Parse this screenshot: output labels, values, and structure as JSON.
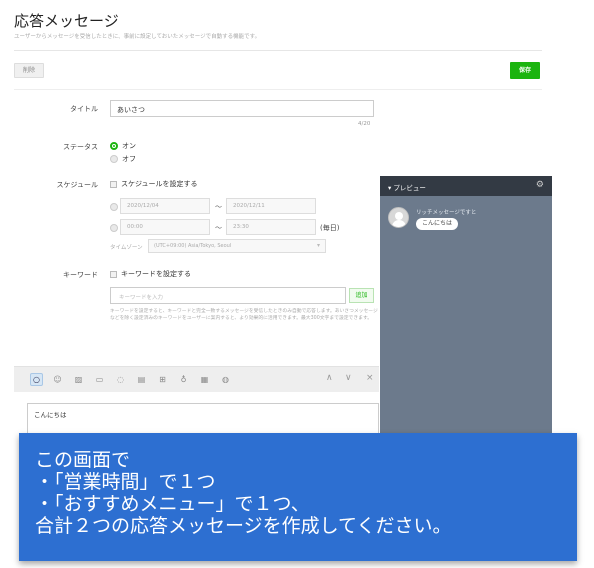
{
  "header": {
    "title": "応答メッセージ",
    "subtitle": "ユーザーからメッセージを受信したときに、事前に設定しておいたメッセージで自動する機能です。"
  },
  "actions": {
    "delete_label": "削除",
    "save_label": "保存"
  },
  "form": {
    "title_label": "タイトル",
    "title_value": "あいさつ",
    "title_counter": "4/20",
    "status_label": "ステータス",
    "status_on": "オン",
    "status_off": "オフ",
    "status_selected": "on",
    "schedule_label": "スケジュール",
    "schedule_checkbox": "スケジュールを設定する",
    "date_start": "2020/12/04",
    "date_end": "2020/12/11",
    "time_start": "00:00",
    "time_end": "23:30",
    "separator": "～",
    "daily": "(毎日)",
    "timezone_label": "タイムゾーン",
    "timezone_value": "(UTC+09:00) Asia/Tokyo, Seoul",
    "keyword_label": "キーワード",
    "keyword_checkbox": "キーワードを設定する",
    "keyword_placeholder": "キーワードを入力",
    "keyword_add": "追加",
    "keyword_help": "キーワードを設定すると、キーワードと完全一致するメッセージを受信したときのみ自動で応答します。あいさつメッセージなどを除く設定済みのキーワードをユーザーに案内すると、より効果的に活用できます。最大300文字まで設定できます。"
  },
  "editor": {
    "text": "こんにちは",
    "tools": [
      "speech-bubble-icon",
      "sticker-icon",
      "image-icon",
      "video-icon",
      "chat-icon",
      "coupon-icon",
      "card-icon",
      "mic-icon",
      "rich-icon",
      "survey-icon"
    ],
    "controls": [
      "∧",
      "∨",
      "×"
    ]
  },
  "preview": {
    "title": "▾ プレビュー",
    "sender_name": "リッチメッセージですと",
    "bubble_text": "こんにちは"
  },
  "overlay": {
    "line1": "この画面で",
    "line2": "・「営業時間」で１つ",
    "line3": "・「おすすめメニュー」で１つ、",
    "line4": "合計２つの応答メッセージを作成してください。"
  }
}
